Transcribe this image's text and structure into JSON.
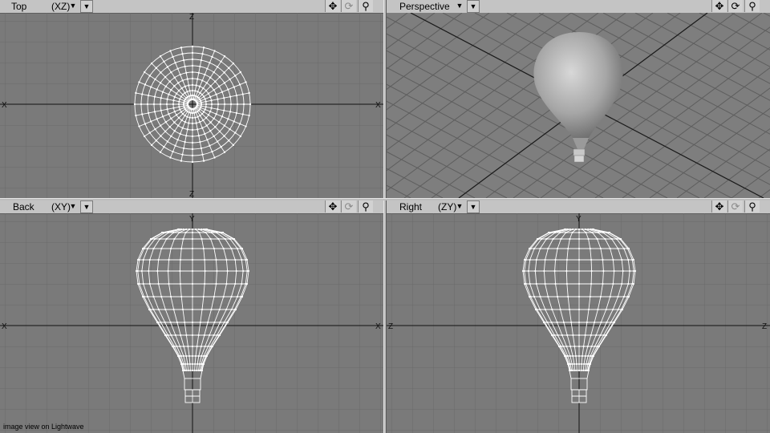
{
  "viewports": {
    "top": {
      "name": "Top",
      "axes": "(XZ)"
    },
    "perspective": {
      "name": "Perspective",
      "axes": ""
    },
    "back": {
      "name": "Back",
      "axes": "(XY)"
    },
    "right": {
      "name": "Right",
      "axes": "(ZY)"
    }
  },
  "icons": {
    "pan": "move-icon",
    "rotate": "rotate-icon",
    "zoom": "magnifier-icon"
  },
  "colors": {
    "viewport_bg": "#7a7a7a",
    "toolbar_bg": "#c4c4c4",
    "wireframe": "#ffffff",
    "grid": "#6a6a6a",
    "axis": "#111111"
  },
  "caption": "image view on Lightwave"
}
